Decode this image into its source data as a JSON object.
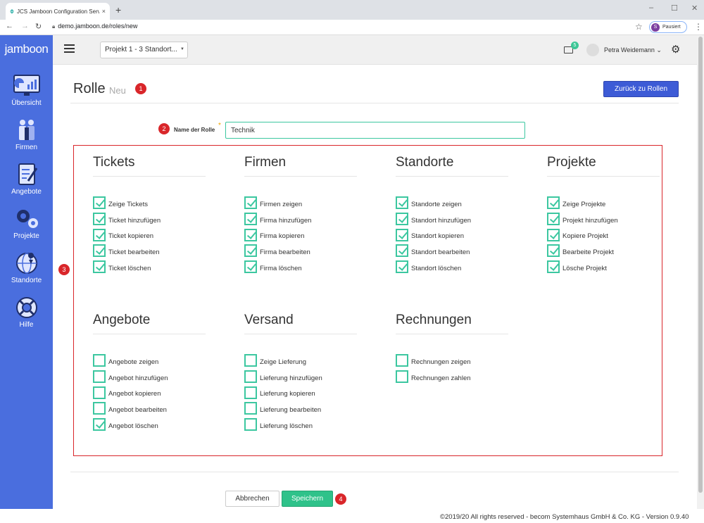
{
  "browser": {
    "tab_title": "JCS Jamboon Configuration Serv",
    "tab_close": "×",
    "new_tab": "+",
    "url": "demo.jamboon.de/roles/new",
    "profile_initial": "S",
    "profile_status": "Pausiert"
  },
  "sidebar": {
    "logo": "jamboon",
    "items": [
      {
        "label": "Übersicht",
        "icon": "dashboard-icon"
      },
      {
        "label": "Firmen",
        "icon": "people-icon"
      },
      {
        "label": "Angebote",
        "icon": "document-icon"
      },
      {
        "label": "Projekte",
        "icon": "gears-icon"
      },
      {
        "label": "Standorte",
        "icon": "globe-icon"
      },
      {
        "label": "Hilfe",
        "icon": "lifebuoy-icon"
      }
    ],
    "color": "#4a6ede"
  },
  "topbar": {
    "project_select": "Projekt 1 - 3 Standort...",
    "mail_count": "5",
    "user_name": "Petra Weidemann"
  },
  "page": {
    "title": "Rolle",
    "subtitle": "Neu",
    "back_button": "Zurück zu Rollen",
    "name_label": "Name der Rolle",
    "name_value": "Technik"
  },
  "badges": [
    "1",
    "2",
    "3",
    "4"
  ],
  "groups": [
    {
      "title": "Tickets",
      "items": [
        {
          "label": "Zeige Tickets",
          "checked": true
        },
        {
          "label": "Ticket hinzufügen",
          "checked": true
        },
        {
          "label": "Ticket kopieren",
          "checked": true
        },
        {
          "label": "Ticket bearbeiten",
          "checked": true
        },
        {
          "label": "Ticket löschen",
          "checked": true
        }
      ]
    },
    {
      "title": "Firmen",
      "items": [
        {
          "label": "Firmen zeigen",
          "checked": true
        },
        {
          "label": "Firma hinzufügen",
          "checked": true
        },
        {
          "label": "Firma kopieren",
          "checked": true
        },
        {
          "label": "Firma bearbeiten",
          "checked": true
        },
        {
          "label": "Firma löschen",
          "checked": true
        }
      ]
    },
    {
      "title": "Standorte",
      "items": [
        {
          "label": "Standorte zeigen",
          "checked": true
        },
        {
          "label": "Standort hinzufügen",
          "checked": true
        },
        {
          "label": "Standort kopieren",
          "checked": true
        },
        {
          "label": "Standort bearbeiten",
          "checked": true
        },
        {
          "label": "Standort löschen",
          "checked": true
        }
      ]
    },
    {
      "title": "Projekte",
      "items": [
        {
          "label": "Zeige Projekte",
          "checked": true
        },
        {
          "label": "Projekt hinzufügen",
          "checked": true
        },
        {
          "label": "Kopiere Projekt",
          "checked": true
        },
        {
          "label": "Bearbeite Projekt",
          "checked": true
        },
        {
          "label": "Lösche Projekt",
          "checked": true
        }
      ]
    },
    {
      "title": "Angebote",
      "items": [
        {
          "label": "Angebote zeigen",
          "checked": false
        },
        {
          "label": "Angebot hinzufügen",
          "checked": false
        },
        {
          "label": "Angebot kopieren",
          "checked": false
        },
        {
          "label": "Angebot bearbeiten",
          "checked": false
        },
        {
          "label": "Angebot löschen",
          "checked": true
        }
      ]
    },
    {
      "title": "Versand",
      "items": [
        {
          "label": "Zeige Lieferung",
          "checked": false
        },
        {
          "label": "Lieferung hinzufügen",
          "checked": false
        },
        {
          "label": "Lieferung kopieren",
          "checked": false
        },
        {
          "label": "Lieferung bearbeiten",
          "checked": false
        },
        {
          "label": "Lieferung löschen",
          "checked": false
        }
      ]
    },
    {
      "title": "Rechnungen",
      "items": [
        {
          "label": "Rechnungen zeigen",
          "checked": false
        },
        {
          "label": "Rechnungen zahlen",
          "checked": false
        }
      ]
    }
  ],
  "actions": {
    "cancel": "Abbrechen",
    "save": "Speichern"
  },
  "footer": "©2019/20 All rights reserved - becom Systemhaus GmbH & Co. KG - Version 0.9.40",
  "colors": {
    "accent_green": "#3cc7a0",
    "primary_blue": "#3d5bd6",
    "badge_red": "#d9262a"
  }
}
